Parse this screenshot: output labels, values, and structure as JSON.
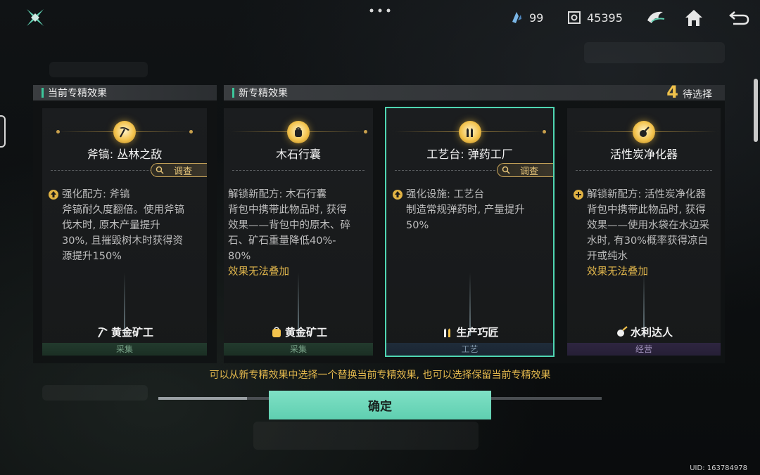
{
  "topbar": {
    "resource_1_value": "99",
    "resource_2_value": "45395",
    "resource_1_icon": "shard-icon",
    "resource_2_icon": "gear-box-icon",
    "buttons": [
      "faction-emblem-icon",
      "home-icon",
      "back-icon"
    ]
  },
  "current_panel": {
    "title": "当前专精效果"
  },
  "new_panel": {
    "title": "新专精效果",
    "pending_count": "4",
    "pending_label": "待选择"
  },
  "investigate_label": "调查",
  "cards": [
    {
      "name": "斧镐: 丛林之敌",
      "icon": "pickaxe-icon",
      "has_investigate": true,
      "bullet_icon": "upgrade-icon",
      "lines": [
        "强化配方: 斧镐",
        "斧镐耐久度翻倍。使用斧镐",
        "伐木时, 原木产量提升",
        "30%, 且摧毁树木时获得资",
        "源提升150%"
      ],
      "warn": "",
      "skill": "黄金矿工",
      "category": "采集"
    },
    {
      "name": "木石行囊",
      "icon": "backpack-icon",
      "has_investigate": false,
      "bullet_icon": "",
      "lines": [
        "解锁新配方: 木石行囊",
        "背包中携带此物品时, 获得",
        "效果——背包中的原木、碎",
        "石、矿石重量降低40%-",
        "80%"
      ],
      "warn": "效果无法叠加",
      "skill": "黄金矿工",
      "category": "采集"
    },
    {
      "name": "工艺台: 弹药工厂",
      "icon": "ammo-icon",
      "has_investigate": true,
      "bullet_icon": "upgrade-icon",
      "lines": [
        "强化设施: 工艺台",
        "制造常规弹药时, 产量提升",
        "50%"
      ],
      "warn": "",
      "skill": "生产巧匠",
      "category": "工艺"
    },
    {
      "name": "活性炭净化器",
      "icon": "purifier-icon",
      "has_investigate": false,
      "bullet_icon": "unlock-icon",
      "lines": [
        "解锁新配方: 活性炭净化器",
        "背包中携带此物品时, 获得",
        "效果——使用水袋在水边采",
        "水时, 有30%概率获得凉白",
        "开或纯水"
      ],
      "warn": "效果无法叠加",
      "skill": "水利达人",
      "category": "经营"
    }
  ],
  "hint": "可以从新专精效果中选择一个替换当前专精效果, 也可以选择保留当前专精效果",
  "confirm_label": "确定",
  "uid": "UID: 163784978",
  "colors": {
    "accent": "#5fcfb0",
    "gold": "#e3b84d",
    "selected_outline": "#4fd6b2"
  }
}
